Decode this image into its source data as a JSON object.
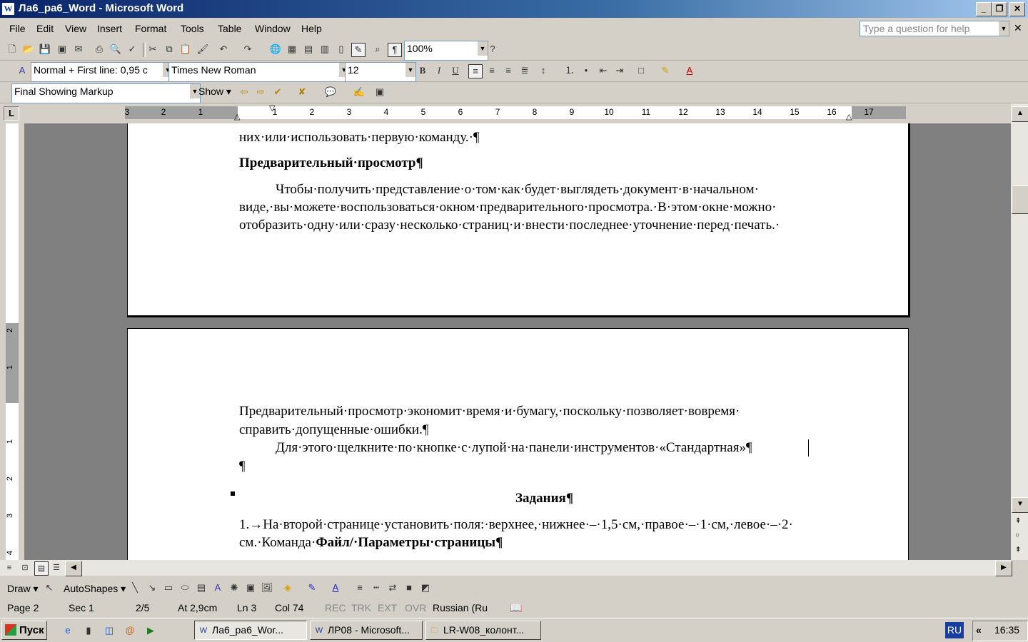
{
  "window": {
    "title": "Ла6_ра6_Word - Microsoft Word",
    "app_icon": "W"
  },
  "menu": {
    "items": [
      "File",
      "Edit",
      "View",
      "Insert",
      "Format",
      "Tools",
      "Table",
      "Window",
      "Help"
    ],
    "help_placeholder": "Type a question for help"
  },
  "standard_toolbar": {
    "zoom": "100%"
  },
  "formatting_toolbar": {
    "style": "Normal + First line:  0,95 с",
    "font": "Times New Roman",
    "size": "12",
    "bold": "B",
    "italic": "I",
    "underline": "U"
  },
  "reviewing_toolbar": {
    "display": "Final Showing Markup",
    "show_label": "Show"
  },
  "ruler": {
    "corner": "L",
    "left_numbers": [
      "3",
      "2",
      "1"
    ],
    "numbers": [
      "1",
      "2",
      "3",
      "4",
      "5",
      "6",
      "7",
      "8",
      "9",
      "10",
      "11",
      "12",
      "13",
      "14",
      "15",
      "16",
      "17"
    ],
    "vertical_numbers": [
      "2",
      "1",
      "1",
      "2",
      "3",
      "4"
    ]
  },
  "document": {
    "page1": {
      "partial_line": "них·или·использовать·первую·команду.·¶",
      "heading": "Предварительный·просмотр¶",
      "para_lines": [
        "Чтобы·получить·представление·о·том·как·будет·выглядеть·документ·в·начальном·",
        "виде,·вы·можете·воспользоваться·окном·предварительного·просмотра.·В·этом·окне·можно·",
        "отобразить·одну·или·сразу·несколько·страниц·и·внести·последнее·уточнение·перед·печать.·"
      ]
    },
    "page2": {
      "para1_lines": [
        "Предварительный·просмотр·экономит·время·и·бумагу,·поскольку·позволяет·вовремя·",
        "справить·допущенные·ошибки.¶"
      ],
      "para2_line": "Для·этого·щелкните·по·кнопке·с·лупой·на·панели·инструментов·«Стандартная»¶",
      "empty_para": "¶",
      "heading": "Задания¶",
      "task1_prefix": "1.→На·второй·странице·установить·поля:·верхнее,·нижнее·–·1,5·см,·правое·–·1·см,·левое·–·2·",
      "task1_cont": "см.·Команда·",
      "task1_bold": "Файл/·Параметры·страницы¶"
    }
  },
  "drawing_toolbar": {
    "draw": "Draw",
    "autoshapes": "AutoShapes"
  },
  "status": {
    "page": "Page 2",
    "sec": "Sec 1",
    "pages": "2/5",
    "at": "At 2,9cm",
    "ln": "Ln 3",
    "col": "Col 74",
    "rec": "REC",
    "trk": "TRK",
    "ext": "EXT",
    "ovr": "OVR",
    "lang": "Russian (Ru"
  },
  "taskbar": {
    "start": "Пуск",
    "tasks": [
      "Ла6_ра6_Wor...",
      "ЛР08 - Microsoft...",
      "LR-W08_колонт..."
    ],
    "lang": "RU",
    "clock": "16:35"
  }
}
